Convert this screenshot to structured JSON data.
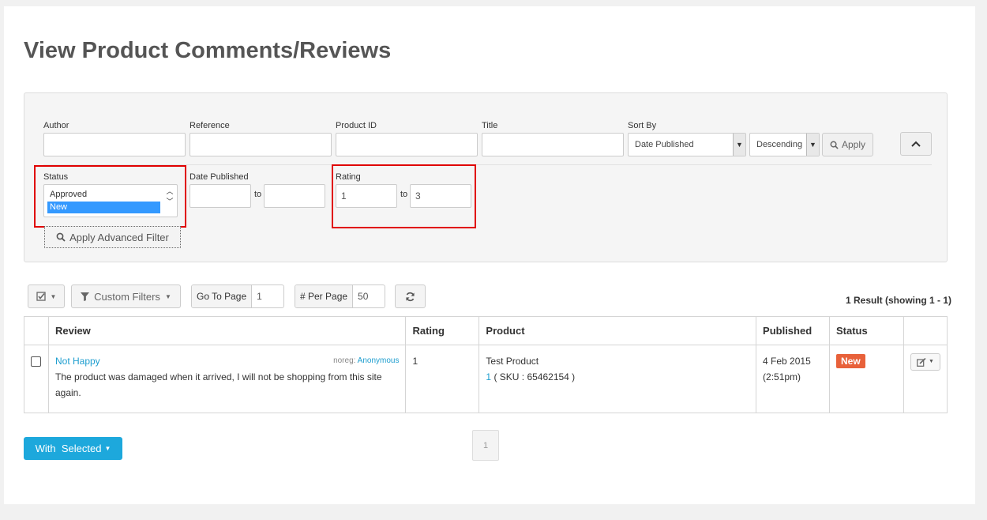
{
  "page_title": "View Product Comments/Reviews",
  "filters": {
    "author": {
      "label": "Author",
      "value": ""
    },
    "reference": {
      "label": "Reference",
      "value": ""
    },
    "product_id": {
      "label": "Product ID",
      "value": ""
    },
    "title": {
      "label": "Title",
      "value": ""
    },
    "sort_by": {
      "label": "Sort By",
      "selected": "Date Published",
      "order": "Descending"
    },
    "apply_label": "Apply",
    "status": {
      "label": "Status",
      "options": [
        "Approved",
        "New"
      ],
      "selected": "New"
    },
    "date_published": {
      "label": "Date Published",
      "from": "",
      "to_label": "to",
      "to": ""
    },
    "rating": {
      "label": "Rating",
      "from": "1",
      "to_label": "to",
      "to": "3"
    },
    "advanced_apply_label": "Apply Advanced Filter"
  },
  "toolbar": {
    "custom_filters_label": "Custom Filters",
    "go_to_page_label": "Go To Page",
    "go_to_page_value": "1",
    "per_page_label": "# Per Page",
    "per_page_value": "50"
  },
  "results_summary": "1 Result (showing 1 - 1)",
  "table": {
    "columns": [
      "Review",
      "Rating",
      "Product",
      "Published",
      "Status"
    ],
    "rows": [
      {
        "title": "Not Happy",
        "author_prefix": "noreg:",
        "author": "Anonymous",
        "text": "The product was damaged when it arrived, I will not be shopping from this site again.",
        "rating": "1",
        "product_name": "Test Product",
        "product_id": "1",
        "sku": "( SKU : 65462154 )",
        "published_date": "4 Feb 2015",
        "published_time": "(2:51pm)",
        "status": "New"
      }
    ]
  },
  "with_selected_label": "With  Selected",
  "pagination": {
    "current_page": "1"
  },
  "colors": {
    "accent": "#1da8dc",
    "status_new": "#e8613a",
    "highlight_border": "#e00000"
  }
}
